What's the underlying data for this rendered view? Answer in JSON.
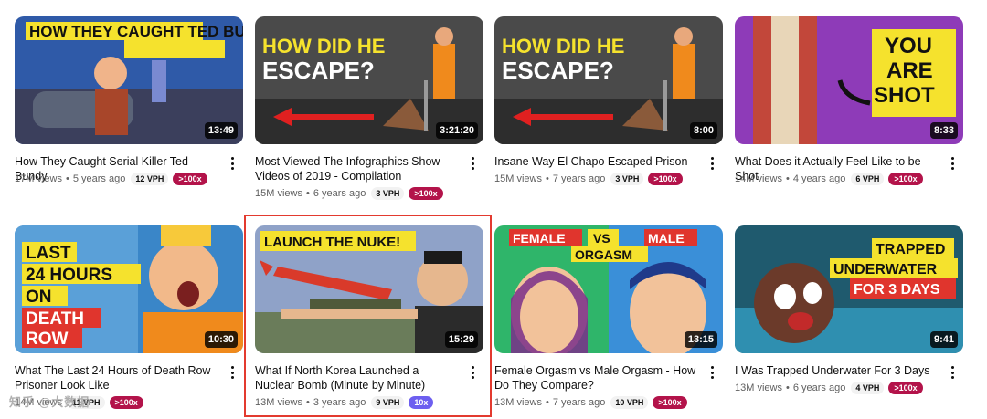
{
  "colors": {
    "badge_red": "#b3134a",
    "badge_purple": "#6d5ff0",
    "highlight_border": "#e33a2f"
  },
  "videos": [
    {
      "thumb_text": "HOW THEY CAUGHT TED BUNDY",
      "duration": "13:49",
      "title": "How They Caught Serial Killer Ted Bundy",
      "views": "17M views",
      "age": "5 years ago",
      "vph": "12 VPH",
      "multiplier": ">100x"
    },
    {
      "thumb_text": "HOW DID HE ESCAPE?",
      "duration": "3:21:20",
      "title": "Most Viewed The Infographics Show Videos of 2019 - Compilation",
      "views": "15M views",
      "age": "6 years ago",
      "vph": "3 VPH",
      "multiplier": ">100x"
    },
    {
      "thumb_text": "HOW DID HE ESCAPE?",
      "duration": "8:00",
      "title": "Insane Way El Chapo Escaped Prison",
      "views": "15M views",
      "age": "7 years ago",
      "vph": "3 VPH",
      "multiplier": ">100x"
    },
    {
      "thumb_text": "YOU ARE SHOT",
      "duration": "8:33",
      "title": "What Does it Actually Feel Like to be Shot",
      "views": "14M views",
      "age": "4 years ago",
      "vph": "6 VPH",
      "multiplier": ">100x"
    },
    {
      "thumb_text": "LAST 24 HOURS ON DEATH ROW",
      "duration": "10:30",
      "title": "What The Last 24 Hours of Death Row Prisoner Look Like",
      "views": "14M views",
      "age": "",
      "vph": "11 VPH",
      "multiplier": ">100x"
    },
    {
      "thumb_text": "LAUNCH THE NUKE!",
      "duration": "15:29",
      "title": "What If North Korea Launched a Nuclear Bomb (Minute by Minute)",
      "views": "13M views",
      "age": "3 years ago",
      "vph": "9 VPH",
      "multiplier": "10x"
    },
    {
      "thumb_text": "FEMALE VS MALE ORGASM",
      "duration": "13:15",
      "title": "Female Orgasm vs Male Orgasm - How Do They Compare?",
      "views": "13M views",
      "age": "7 years ago",
      "vph": "10 VPH",
      "multiplier": ">100x"
    },
    {
      "thumb_text": "TRAPPED UNDERWATER FOR 3 DAYS",
      "duration": "9:41",
      "title": "I Was Trapped Underwater For 3 Days",
      "views": "13M views",
      "age": "6 years ago",
      "vph": "4 VPH",
      "multiplier": ">100x"
    }
  ],
  "watermark": "知乎 @大数据"
}
